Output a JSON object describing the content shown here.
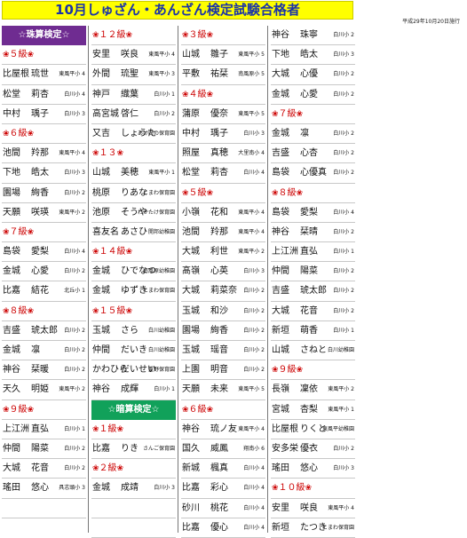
{
  "title": "10月しゅざん・あんざん検定試験合格者",
  "date": "平成29年10月20日施行",
  "flower_icon": "❀",
  "columns": [
    [
      {
        "t": "section",
        "label": "☆珠算検定☆",
        "color": "#6f2c91"
      },
      {
        "t": "head",
        "label": "５級"
      },
      {
        "t": "p",
        "ln": "比屋根",
        "fn": "琉世",
        "sc": "東風平小 4"
      },
      {
        "t": "p",
        "ln": "松堂",
        "fn": "莉杏",
        "sc": "白川小 4"
      },
      {
        "t": "p",
        "ln": "中村",
        "fn": "瑀子",
        "sc": "白川小 3"
      },
      {
        "t": "head",
        "label": "６級"
      },
      {
        "t": "p",
        "ln": "池間",
        "fn": "羚那",
        "sc": "東風平小 4"
      },
      {
        "t": "p",
        "ln": "下地",
        "fn": "皓太",
        "sc": "白川小 3"
      },
      {
        "t": "p",
        "ln": "園場",
        "fn": "絢香",
        "sc": "白川小 2"
      },
      {
        "t": "p",
        "ln": "天願",
        "fn": "咲瑛",
        "sc": "東風平小 2"
      },
      {
        "t": "head",
        "label": "７級"
      },
      {
        "t": "p",
        "ln": "島袋",
        "fn": "愛梨",
        "sc": "白川小 4"
      },
      {
        "t": "p",
        "ln": "金城",
        "fn": "心愛",
        "sc": "白川小 2"
      },
      {
        "t": "p",
        "ln": "比嘉",
        "fn": "結花",
        "sc": "北丘小 1"
      },
      {
        "t": "head",
        "label": "８級"
      },
      {
        "t": "p",
        "ln": "吉盛",
        "fn": "琥太郎",
        "sc": "白川小 2"
      },
      {
        "t": "p",
        "ln": "金城",
        "fn": "凛",
        "sc": "白川小 2"
      },
      {
        "t": "p",
        "ln": "神谷",
        "fn": "栞暖",
        "sc": "白川小 2"
      },
      {
        "t": "p",
        "ln": "天久",
        "fn": "明姫",
        "sc": "東風平小 2"
      },
      {
        "t": "head",
        "label": "９級"
      },
      {
        "t": "p",
        "ln": "上江洲",
        "fn": "直弘",
        "sc": "白川小 1"
      },
      {
        "t": "p",
        "ln": "仲間",
        "fn": "陽菜",
        "sc": "白川小 2"
      },
      {
        "t": "p",
        "ln": "大城",
        "fn": "花音",
        "sc": "白川小 2"
      },
      {
        "t": "p",
        "ln": "瑤田",
        "fn": "悠心",
        "sc": "具志頭小 3"
      },
      {
        "t": "blank"
      }
    ],
    [
      {
        "t": "head",
        "label": "１２級"
      },
      {
        "t": "p",
        "ln": "安里",
        "fn": "咲良",
        "sc": "東風平小 4"
      },
      {
        "t": "p",
        "ln": "外間",
        "fn": "琉聖",
        "sc": "東風平小 3"
      },
      {
        "t": "p",
        "ln": "神戸",
        "fn": "織葉",
        "sc": "白川小 1"
      },
      {
        "t": "p",
        "ln": "高宮城",
        "fn": "啓仁",
        "sc": "白川小 2"
      },
      {
        "t": "p",
        "ln": "又吉",
        "fn": "しょうた",
        "sc": "あけぼの保育園"
      },
      {
        "t": "head",
        "label": "１３"
      },
      {
        "t": "p",
        "ln": "山城",
        "fn": "美穂",
        "sc": "東風平小 1"
      },
      {
        "t": "p",
        "ln": "桃原",
        "fn": "りあな",
        "sc": "とまわ保育園"
      },
      {
        "t": "p",
        "ln": "池原",
        "fn": "そうや",
        "sc": "わかたけ保育園"
      },
      {
        "t": "p",
        "ln": "喜友名",
        "fn": "あさひ",
        "sc": "開邦幼稚園"
      },
      {
        "t": "head",
        "label": "１４級"
      },
      {
        "t": "p",
        "ln": "金城",
        "fn": "ひでなつ",
        "sc": "南風原幼稚園"
      },
      {
        "t": "p",
        "ln": "金城",
        "fn": "ゆずき",
        "sc": "とまわ保育園"
      },
      {
        "t": "head",
        "label": "１５級"
      },
      {
        "t": "p",
        "ln": "玉城",
        "fn": "さら",
        "sc": "白川幼稚園"
      },
      {
        "t": "p",
        "ln": "仲間",
        "fn": "だいき",
        "sc": "白川幼稚園"
      },
      {
        "t": "p",
        "ln": "かわひら",
        "fn": "だいせい",
        "sc": "重野保育園"
      },
      {
        "t": "p",
        "ln": "神谷",
        "fn": "成輝",
        "sc": "白川小 1"
      },
      {
        "t": "section",
        "label": "☆暗算検定☆",
        "color": "#11a15a"
      },
      {
        "t": "head",
        "label": "１級"
      },
      {
        "t": "p",
        "ln": "比嘉",
        "fn": "りき",
        "sc": "さんご保育園"
      },
      {
        "t": "head",
        "label": "２級"
      },
      {
        "t": "p",
        "ln": "金城",
        "fn": "成靖",
        "sc": "白川小 3"
      },
      {
        "t": "blank"
      },
      {
        "t": "blank"
      }
    ],
    [
      {
        "t": "head",
        "label": "３級"
      },
      {
        "t": "p",
        "ln": "山城",
        "fn": "雛子",
        "sc": "東風平小 5"
      },
      {
        "t": "p",
        "ln": "平敷",
        "fn": "祐栞",
        "sc": "南風原小 5"
      },
      {
        "t": "head",
        "label": "４級"
      },
      {
        "t": "p",
        "ln": "蒲原",
        "fn": "優奈",
        "sc": "東風平小 5"
      },
      {
        "t": "p",
        "ln": "中村",
        "fn": "瑀子",
        "sc": "白川小 3"
      },
      {
        "t": "p",
        "ln": "照屋",
        "fn": "真穂",
        "sc": "大里南小 4"
      },
      {
        "t": "p",
        "ln": "松堂",
        "fn": "莉杏",
        "sc": "白川小 4"
      },
      {
        "t": "head",
        "label": "５級"
      },
      {
        "t": "p",
        "ln": "小嶺",
        "fn": "花和",
        "sc": "東風平小 4"
      },
      {
        "t": "p",
        "ln": "池間",
        "fn": "羚那",
        "sc": "東風平小 4"
      },
      {
        "t": "p",
        "ln": "大城",
        "fn": "利世",
        "sc": "東風平小 2"
      },
      {
        "t": "p",
        "ln": "髙嶺",
        "fn": "心英",
        "sc": "白川小 3"
      },
      {
        "t": "p",
        "ln": "大城",
        "fn": "莉菜奈",
        "sc": "白川小 2"
      },
      {
        "t": "p",
        "ln": "玉城",
        "fn": "和沙",
        "sc": "白川小 2"
      },
      {
        "t": "p",
        "ln": "園場",
        "fn": "絢香",
        "sc": "白川小 2"
      },
      {
        "t": "p",
        "ln": "玉城",
        "fn": "瑶音",
        "sc": "白川小 2"
      },
      {
        "t": "p",
        "ln": "上園",
        "fn": "明音",
        "sc": "白川小 2"
      },
      {
        "t": "p",
        "ln": "天願",
        "fn": "未来",
        "sc": "東風平小 5"
      },
      {
        "t": "head",
        "label": "６級"
      },
      {
        "t": "p",
        "ln": "神谷",
        "fn": "琉ノ友",
        "sc": "東風平小 4"
      },
      {
        "t": "p",
        "ln": "国久",
        "fn": "威鳳",
        "sc": "翔南小 6"
      },
      {
        "t": "p",
        "ln": "新城",
        "fn": "楓真",
        "sc": "白川小 4"
      },
      {
        "t": "p",
        "ln": "比嘉",
        "fn": "彩心",
        "sc": "白川小 4"
      },
      {
        "t": "p",
        "ln": "砂川",
        "fn": "桃花",
        "sc": "白川小 4"
      },
      {
        "t": "p",
        "ln": "比嘉",
        "fn": "優心",
        "sc": "白川小 4"
      }
    ],
    [
      {
        "t": "p",
        "ln": "神谷",
        "fn": "珠寧",
        "sc": "白川小 2"
      },
      {
        "t": "p",
        "ln": "下地",
        "fn": "皓太",
        "sc": "白川小 3"
      },
      {
        "t": "p",
        "ln": "大城",
        "fn": "心優",
        "sc": "白川小 2"
      },
      {
        "t": "p",
        "ln": "金城",
        "fn": "心愛",
        "sc": "白川小 2"
      },
      {
        "t": "head",
        "label": "７級"
      },
      {
        "t": "p",
        "ln": "金城",
        "fn": "凛",
        "sc": "白川小 2"
      },
      {
        "t": "p",
        "ln": "吉盛",
        "fn": "心杏",
        "sc": "白川小 2"
      },
      {
        "t": "p",
        "ln": "島袋",
        "fn": "心優真",
        "sc": "白川小 2"
      },
      {
        "t": "head",
        "label": "８級"
      },
      {
        "t": "p",
        "ln": "島袋",
        "fn": "愛梨",
        "sc": "白川小 4"
      },
      {
        "t": "p",
        "ln": "神谷",
        "fn": "栞晴",
        "sc": "白川小 2"
      },
      {
        "t": "p",
        "ln": "上江洲",
        "fn": "直弘",
        "sc": "白川小 1"
      },
      {
        "t": "p",
        "ln": "仲間",
        "fn": "陽菜",
        "sc": "白川小 2"
      },
      {
        "t": "p",
        "ln": "吉盛",
        "fn": "琥太郎",
        "sc": "白川小 2"
      },
      {
        "t": "p",
        "ln": "大城",
        "fn": "花音",
        "sc": "白川小 2"
      },
      {
        "t": "p",
        "ln": "新垣",
        "fn": "萌香",
        "sc": "白川小 1"
      },
      {
        "t": "p",
        "ln": "山城",
        "fn": "さねと",
        "sc": "白川幼稚園"
      },
      {
        "t": "head",
        "label": "９級"
      },
      {
        "t": "p",
        "ln": "長嶺",
        "fn": "凜依",
        "sc": "東風平小 2"
      },
      {
        "t": "p",
        "ln": "宮城",
        "fn": "杏梨",
        "sc": "東風平小 1"
      },
      {
        "t": "p",
        "ln": "比屋根",
        "fn": "りくと",
        "sc": "東風平幼稚園"
      },
      {
        "t": "p",
        "ln": "安多栄",
        "fn": "優衣",
        "sc": "白川小 2"
      },
      {
        "t": "p",
        "ln": "瑤田",
        "fn": "悠心",
        "sc": "白川小 3"
      },
      {
        "t": "head",
        "label": "１０級"
      },
      {
        "t": "p",
        "ln": "安里",
        "fn": "咲良",
        "sc": "東風平小 4"
      },
      {
        "t": "p",
        "ln": "新垣",
        "fn": "たつき",
        "sc": "とまわ保育園"
      }
    ]
  ]
}
